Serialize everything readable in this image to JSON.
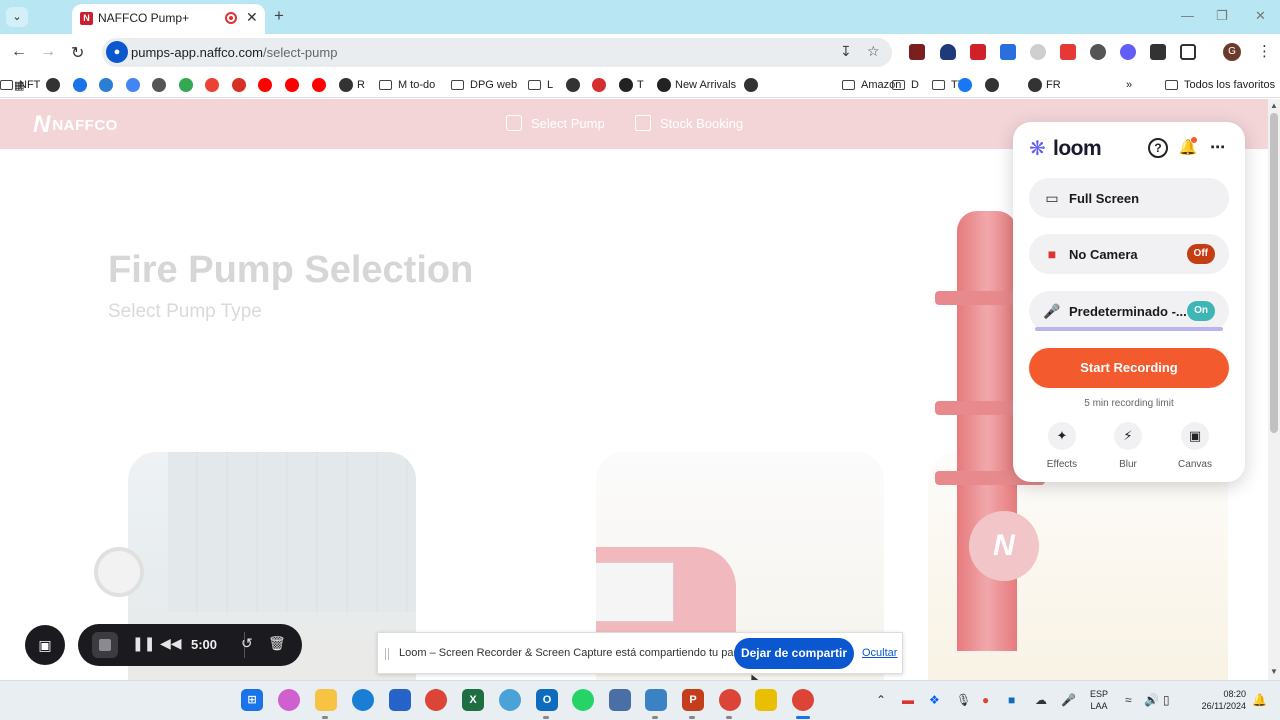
{
  "browser": {
    "tab": {
      "favicon": "N",
      "title": "NAFFCO Pump+",
      "recording_icon": "record-icon",
      "close": "✕"
    },
    "new_tab": "+",
    "dropdown": "⌄",
    "window_controls": {
      "minimize": "—",
      "restore": "❐",
      "close": "✕"
    },
    "nav": {
      "back": "←",
      "forward": "→",
      "reload": "↻"
    },
    "address": {
      "host": "pumps-app.naffco.com",
      "path": "/select-pump"
    },
    "profile_initial": "G",
    "bookmarks": [
      {
        "label": "",
        "icon": "globe-icon",
        "color": "#333333"
      },
      {
        "label": "",
        "icon": "calendar-icon",
        "color": "#1a73e8"
      },
      {
        "label": "",
        "icon": "network-icon",
        "color": "#2a7fd4"
      },
      {
        "label": "",
        "icon": "translate-icon",
        "color": "#4285f4"
      },
      {
        "label": "",
        "icon": "key-icon",
        "color": "#555555"
      },
      {
        "label": "",
        "icon": "maps-icon",
        "color": "#34a853"
      },
      {
        "label": "",
        "icon": "google-icon",
        "color": "#ea4335"
      },
      {
        "label": "",
        "icon": "gmail-icon",
        "color": "#d93025"
      },
      {
        "label": "",
        "icon": "youtube-icon",
        "color": "#ff0000"
      },
      {
        "label": "",
        "icon": "youtube-icon",
        "color": "#ff0000"
      },
      {
        "label": "",
        "icon": "youtube-icon",
        "color": "#ff0000"
      },
      {
        "label": "R",
        "icon": "globe-icon",
        "color": "#333333"
      },
      {
        "label": "M to-do",
        "icon": "folder-icon",
        "color": ""
      },
      {
        "label": "DPG web",
        "icon": "folder-icon",
        "color": ""
      },
      {
        "label": "L",
        "icon": "folder-icon",
        "color": ""
      },
      {
        "label": "",
        "icon": "globe-icon",
        "color": "#333333"
      },
      {
        "label": "",
        "icon": "yandex-icon",
        "color": "#d32f2f"
      },
      {
        "label": "T",
        "icon": "amazon-icon",
        "color": "#222222"
      },
      {
        "label": "New Arrivals",
        "icon": "amazon-icon",
        "color": "#222222"
      },
      {
        "label": "",
        "icon": "globe-icon",
        "color": "#333333"
      },
      {
        "label": "Amazon",
        "icon": "folder-icon",
        "color": ""
      },
      {
        "label": "D",
        "icon": "folder-icon",
        "color": ""
      },
      {
        "label": "TT",
        "icon": "folder-icon",
        "color": ""
      },
      {
        "label": "",
        "icon": "facebook-icon",
        "color": "#1877f2"
      },
      {
        "label": "",
        "icon": "globe-icon",
        "color": "#333333"
      },
      {
        "label": "FR",
        "icon": "globe-icon",
        "color": "#333333"
      },
      {
        "label": "NFT",
        "icon": "folder-icon",
        "color": ""
      }
    ],
    "bookmarks_overflow": "»",
    "all_bookmarks": "Todos los favoritos"
  },
  "site": {
    "logo_mark": "N",
    "logo_text": "NAFFCO",
    "nav": [
      {
        "label": "Select Pump",
        "icon": "pump-icon"
      },
      {
        "label": "Stock Booking",
        "icon": "box-icon"
      }
    ],
    "heading": "Fire Pump Selection",
    "subheading": "Select Pump Type",
    "header_color": "#f3d5d8"
  },
  "loom": {
    "brand": "loom",
    "options": [
      {
        "label": "Full Screen",
        "icon": "monitor-icon",
        "pill": "",
        "pill_color": ""
      },
      {
        "label": "No Camera",
        "icon": "camera-off-icon",
        "pill": "Off",
        "pill_color": "#c43d13"
      },
      {
        "label": "Predeterminado -...",
        "icon": "microphone-icon",
        "pill": "On",
        "pill_color": "#3fb6b6"
      }
    ],
    "start_label": "Start Recording",
    "start_color": "#f35a2e",
    "limit_text": "5 min recording limit",
    "tools": [
      {
        "label": "Effects",
        "icon": "sparkle-icon"
      },
      {
        "label": "Blur",
        "icon": "bolt-icon"
      },
      {
        "label": "Canvas",
        "icon": "image-icon"
      }
    ]
  },
  "recorder": {
    "time": "5:00"
  },
  "share_notice": {
    "message": "Loom – Screen Recorder & Screen Capture está compartiendo tu pantalla.",
    "stop_label": "Dejar de compartir",
    "hide_label": "Ocultar"
  },
  "taskbar": {
    "lang_line1": "ESP",
    "lang_line2": "LAA",
    "time": "08:20",
    "date": "26/11/2024"
  }
}
